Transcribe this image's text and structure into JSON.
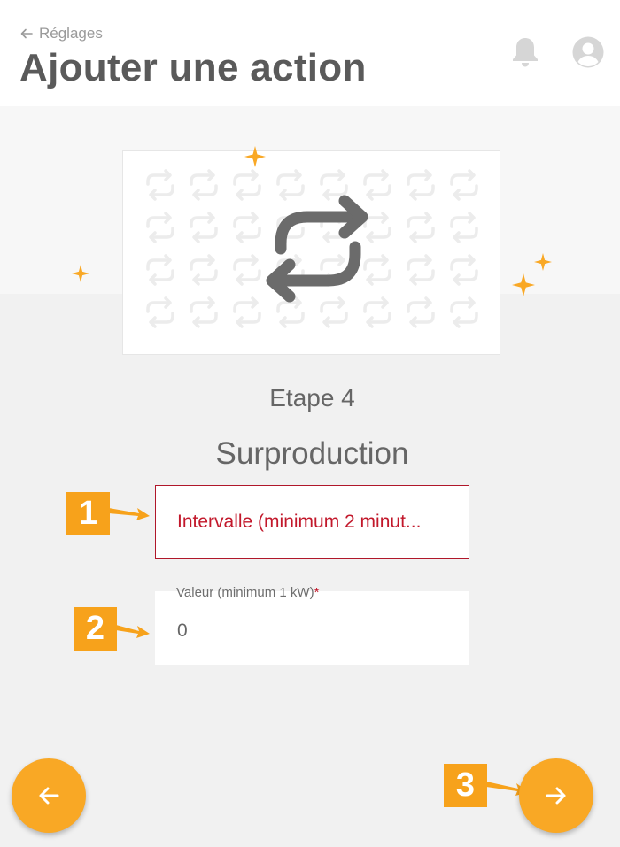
{
  "header": {
    "back_label": "Réglages",
    "title": "Ajouter une action"
  },
  "step": {
    "label": "Etape 4",
    "title": "Surproduction"
  },
  "form": {
    "interval_field": "Intervalle (minimum 2 minut...",
    "value_label": "Valeur (minimum 1 kW)",
    "value_required_mark": "*",
    "value": "0"
  },
  "annotations": {
    "marker_1": "1",
    "marker_2": "2",
    "marker_3": "3"
  },
  "colors": {
    "accent": "#f9a825",
    "marker": "#f7a21b",
    "error": "#c2182b",
    "title": "#5a5a5a"
  },
  "icons": {
    "back": "arrow-left-icon",
    "notifications": "bell-icon",
    "profile": "account-circle-icon",
    "hero": "repeat-icon",
    "previous": "arrow-left-icon",
    "next": "arrow-right-icon"
  }
}
